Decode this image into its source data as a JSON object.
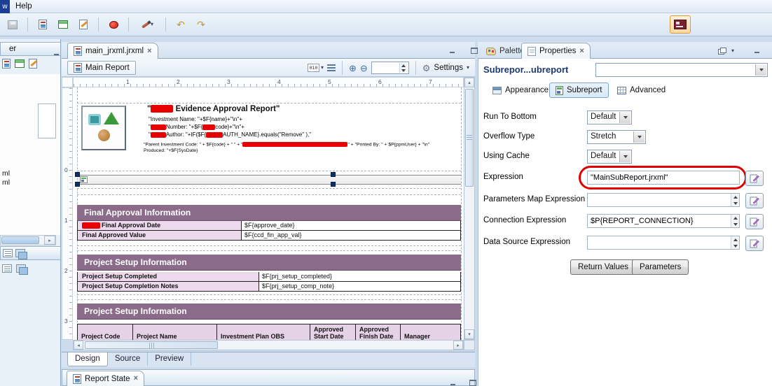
{
  "menubar": {
    "window_fragment": "w",
    "help": "Help"
  },
  "editor": {
    "tab_label": "main_jrxml.jrxml",
    "tab_close": "×",
    "breadcrumb": "Main Report",
    "toolbar": {
      "zoom_badge": "010",
      "settings_label": "Settings"
    },
    "bottom_tabs": {
      "design": "Design",
      "source": "Source",
      "preview": "Preview"
    },
    "report_state_tab": "Report State",
    "report_state_close": "×"
  },
  "rulers": {
    "horizontal": [
      "1",
      "2",
      "3",
      "4",
      "5",
      "6",
      "7"
    ],
    "vertical": [
      "0",
      "1",
      "2",
      "3"
    ]
  },
  "report": {
    "title_open": "\"",
    "title_rest": " Evidence Approval Report\"",
    "code_line_1": "\"Investment Name:   \"+$F{name}+\"\\n\"+",
    "code_line_2a": "\"",
    "code_line_2b": "Number:        \"+$F{",
    "code_line_2c": "code}+\"\\n\"+",
    "code_line_3a": "\"",
    "code_line_3b": "Author:         \"+IF($F{",
    "code_line_3c": "AUTH_NAME}.equals(\"Remove\" ),\"",
    "code_line_4a": "\"Parent Investment Code: \" + $F{code} + \" \" + \"",
    "code_line_4b": "\" + \"Printed By: \" + $P{ppmUser} + \"\\n\"",
    "code_line_5": "Produced: \"+$F{SysDate}",
    "section_final": {
      "header": "Final Approval Information",
      "rows": [
        {
          "label": "Final Approval Date",
          "value": "$F{approve_date}"
        },
        {
          "label": "Final Approved Value",
          "value": "$F{ccd_fin_app_val}"
        }
      ]
    },
    "section_setup": {
      "header": "Project Setup Information",
      "rows": [
        {
          "label": "Project Setup Completed",
          "value": "$F{prj_setup_completed}"
        },
        {
          "label": "Project Setup Completion Notes",
          "value": "$F{prj_setup_comp_note}"
        }
      ]
    },
    "section_table": {
      "header": "Project Setup Information",
      "columns": [
        "Project Code",
        "Project Name",
        "Investment Plan OBS",
        "Approved Start Date",
        "Approved Finish Date",
        "Manager"
      ]
    }
  },
  "left_panels": {
    "top_header_fragment": "er",
    "tree_fragments": [
      "ml",
      "ml"
    ]
  },
  "right_panel": {
    "tabs": {
      "palette": "Palette",
      "properties": "Properties",
      "close": "×"
    },
    "title": "Subrepor...ubreport",
    "subtabs": {
      "appearance": "Appearance",
      "subreport": "Subreport",
      "advanced": "Advanced"
    },
    "fields": {
      "run_to_bottom": {
        "label": "Run To Bottom",
        "value": "Default"
      },
      "overflow_type": {
        "label": "Overflow Type",
        "value": "Stretch"
      },
      "using_cache": {
        "label": "Using Cache",
        "value": "Default"
      },
      "expression": {
        "label": "Expression",
        "value": "\"MainSubReport.jrxml\""
      },
      "parameters_map": {
        "label": "Parameters Map Expression",
        "value": ""
      },
      "connection": {
        "label": "Connection Expression",
        "value": "$P{REPORT_CONNECTION}"
      },
      "data_source": {
        "label": "Data Source Expression",
        "value": ""
      }
    },
    "buttons": {
      "return_values": "Return Values",
      "parameters": "Parameters"
    }
  },
  "colors": {
    "band_purple": "#8a6b8a",
    "cell_lavender": "#ecd9ec",
    "annotation_red": "#e10000",
    "redaction_red": "#e60000"
  }
}
